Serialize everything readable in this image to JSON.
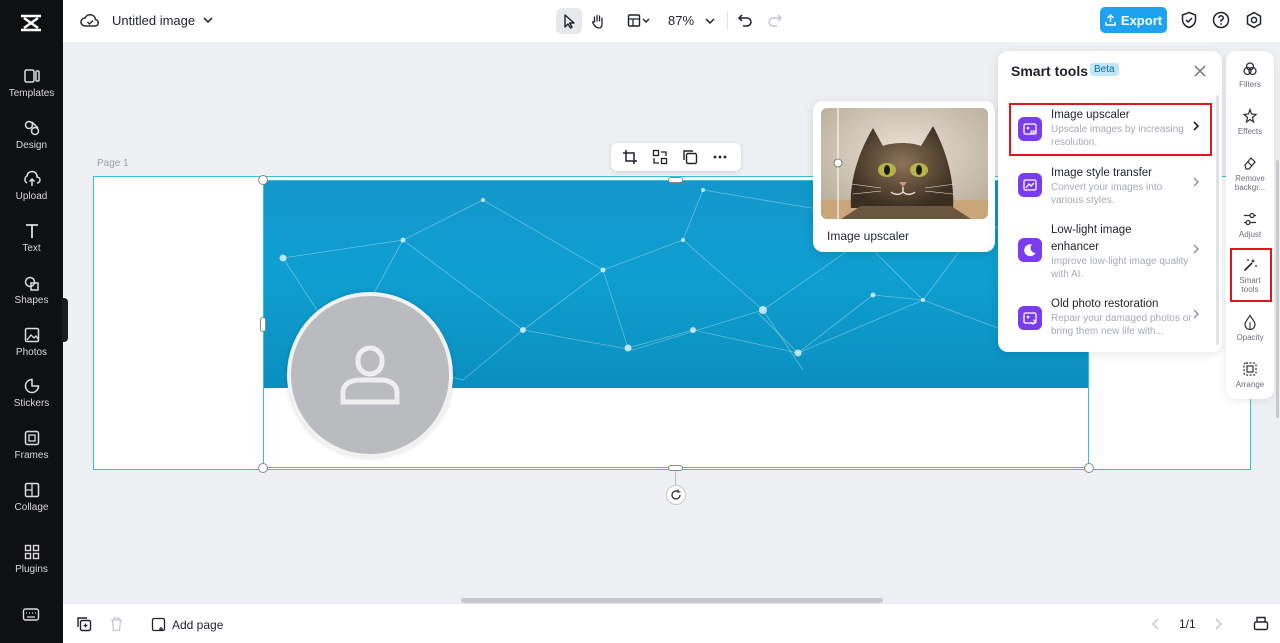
{
  "sidebar": {
    "items": [
      {
        "label": "Templates",
        "icon": "templates-icon"
      },
      {
        "label": "Design",
        "icon": "design-icon"
      },
      {
        "label": "Upload",
        "icon": "upload-icon"
      },
      {
        "label": "Text",
        "icon": "text-icon"
      },
      {
        "label": "Shapes",
        "icon": "shapes-icon"
      },
      {
        "label": "Photos",
        "icon": "photos-icon"
      },
      {
        "label": "Stickers",
        "icon": "stickers-icon"
      },
      {
        "label": "Frames",
        "icon": "frames-icon"
      },
      {
        "label": "Collage",
        "icon": "collage-icon"
      },
      {
        "label": "Plugins",
        "icon": "plugins-icon"
      }
    ]
  },
  "header": {
    "title": "Untitled image",
    "zoom": "87%",
    "export_label": "Export"
  },
  "canvas": {
    "page_label": "Page 1"
  },
  "preview": {
    "caption": "Image upscaler"
  },
  "smart_tools": {
    "title": "Smart tools",
    "badge": "Beta",
    "tools": [
      {
        "name": "Image upscaler",
        "desc": "Upscale images by increasing resolution."
      },
      {
        "name": "Image style transfer",
        "desc": "Convert your images into various styles."
      },
      {
        "name": "Low-light image enhancer",
        "desc": "Improve low-light image quality with AI."
      },
      {
        "name": "Old photo restoration",
        "desc": "Repair your damaged photos or bring them new life with..."
      }
    ]
  },
  "rightbar": {
    "items": [
      {
        "label": "Filters"
      },
      {
        "label": "Effects"
      },
      {
        "label": "Remove backgr..."
      },
      {
        "label": "Adjust"
      },
      {
        "label": "Smart tools"
      },
      {
        "label": "Opacity"
      },
      {
        "label": "Arrange"
      }
    ]
  },
  "footer": {
    "add_page": "Add page",
    "pager": "1/1"
  },
  "colors": {
    "accent": "#1da2f2",
    "banner": "#0e9fd0",
    "highlight": "#e0161d",
    "tool_icon": "#7b3cf0"
  }
}
